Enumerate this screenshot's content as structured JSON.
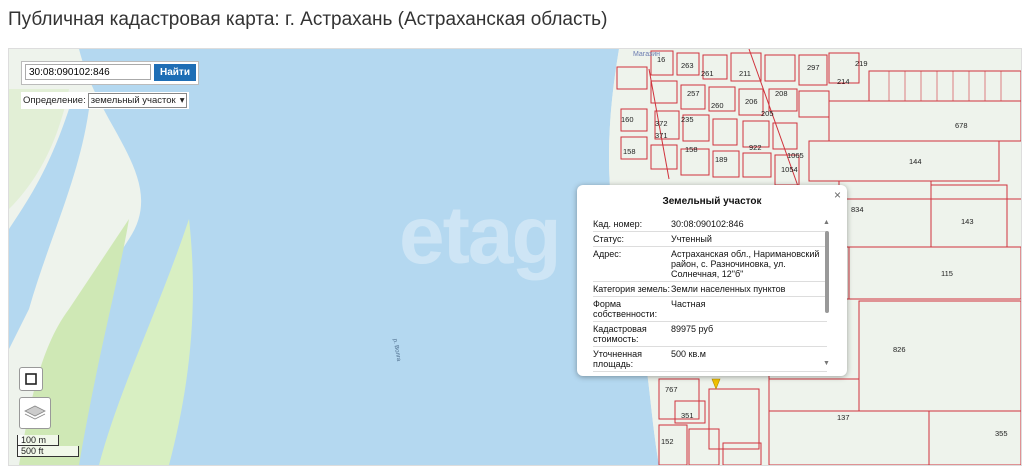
{
  "page": {
    "title": "Публичная кадастровая карта: г. Астрахань (Астраханская область)"
  },
  "search": {
    "value": "30:08:090102:846",
    "button_label": "Найти"
  },
  "definition": {
    "label": "Определение:",
    "selected": "земельный участок"
  },
  "scale": {
    "metric": "100 m",
    "imperial": "500 ft"
  },
  "map_labels": {
    "watermark": "etag",
    "river": "р. Волга",
    "shop": "Магазин"
  },
  "plots": [
    "16",
    "263",
    "261",
    "211",
    "297",
    "214",
    "219",
    "257",
    "208",
    "205",
    "260",
    "206",
    "235",
    "372",
    "371",
    "160",
    "158",
    "158",
    "922",
    "1065",
    "1054",
    "189",
    "678",
    "144",
    "834",
    "143",
    "115",
    "826",
    "767",
    "351",
    "152",
    "137",
    "355"
  ],
  "popup": {
    "title": "Земельный участок",
    "rows": [
      {
        "label": "Кад. номер:",
        "value": "30:08:090102:846"
      },
      {
        "label": "Статус:",
        "value": "Учтенный"
      },
      {
        "label": "Адрес:",
        "value": "Астраханская обл., Наримановский район, с. Разночиновка, ул. Солнечная, 12\"б\""
      },
      {
        "label": "Категория земель:",
        "value": "Земли населенных пунктов"
      },
      {
        "label": "Форма собственности:",
        "value": "Частная"
      },
      {
        "label": "Кадастровая стоимость:",
        "value": "89975 руб"
      },
      {
        "label": "Уточненная площадь:",
        "value": "500 кв.м"
      }
    ]
  },
  "colors": {
    "water": "#b4d8f0",
    "land": "#eef3ec",
    "vegetation": "#cfe8b5",
    "parcel_line": "#d0323c",
    "button": "#1e6eb5"
  }
}
